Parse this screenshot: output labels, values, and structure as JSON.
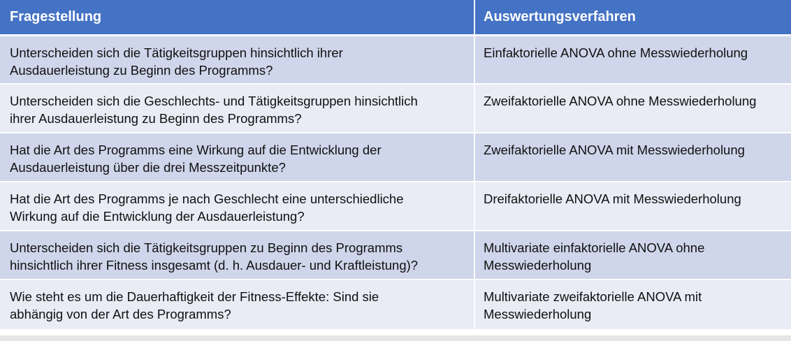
{
  "header": {
    "col1": "Fragestellung",
    "col2": "Auswertungsverfahren"
  },
  "rows": [
    {
      "question_line1": "Unterscheiden sich die Tätigkeitsgruppen hinsichtlich ihrer",
      "question_line2": "Ausdauerleistung zu Beginn des Programms?",
      "method_line1": "Einfaktorielle ANOVA ohne Messwiederholung",
      "method_line2": ""
    },
    {
      "question_line1": "Unterscheiden sich die Geschlechts- und Tätigkeitsgruppen hinsichtlich",
      "question_line2": "ihrer Ausdauerleistung zu Beginn des Programms?",
      "method_line1": "Zweifaktorielle ANOVA ohne Messwiederholung",
      "method_line2": ""
    },
    {
      "question_line1": "Hat die Art des Programms eine Wirkung auf die Entwicklung der",
      "question_line2": "Ausdauerleistung über die drei Messzeitpunkte?",
      "method_line1": "Zweifaktorielle ANOVA mit Messwiederholung",
      "method_line2": ""
    },
    {
      "question_line1": "Hat die Art des Programms je nach Geschlecht eine unterschiedliche",
      "question_line2": "Wirkung auf die Entwicklung der Ausdauerleistung?",
      "method_line1": "Dreifaktorielle ANOVA mit Messwiederholung",
      "method_line2": ""
    },
    {
      "question_line1": "Unterscheiden sich die Tätigkeitsgruppen zu Beginn des Programms",
      "question_line2": "hinsichtlich ihrer Fitness insgesamt (d. h. Ausdauer- und Kraftleistung)?",
      "method_line1": "Multivariate einfaktorielle ANOVA ohne",
      "method_line2": "Messwiederholung"
    },
    {
      "question_line1": "Wie steht es um die Dauerhaftigkeit der Fitness-Effekte: Sind sie",
      "question_line2": "abhängig von der Art des Programms?",
      "method_line1": "Multivariate zweifaktorielle ANOVA mit",
      "method_line2": "Messwiederholung"
    }
  ]
}
